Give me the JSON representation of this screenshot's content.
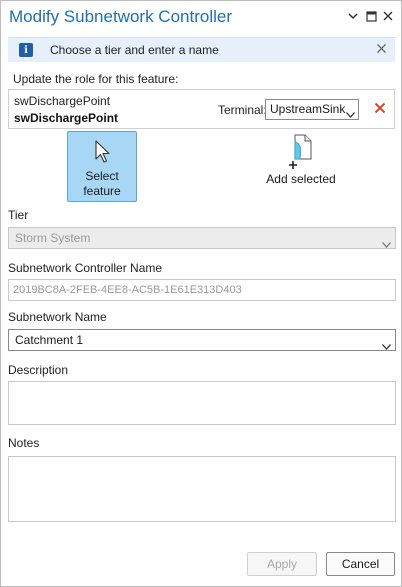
{
  "window": {
    "title": "Modify Subnetwork Controller",
    "controls": [
      "menu-chevron-icon",
      "maximize-icon",
      "close-icon"
    ]
  },
  "info_bar": {
    "icon": "info-icon",
    "message": "Choose a tier and enter a name"
  },
  "feature_section": {
    "label": "Update the role for this feature:",
    "feature_class": "swDischargePoint",
    "feature_name": "swDischargePoint",
    "terminal_label": "Terminal:",
    "terminal_value": "UpstreamSink"
  },
  "tools": {
    "select_feature": {
      "label_line1": "Select",
      "label_line2": "feature",
      "active": true
    },
    "add_selected": {
      "label": "Add selected"
    }
  },
  "tier": {
    "label": "Tier",
    "value": "Storm System",
    "enabled": false
  },
  "controller_name": {
    "label": "Subnetwork Controller Name",
    "placeholder": "2019BC8A-2FEB-4EE8-AC5B-1E61E313D403"
  },
  "subnetwork_name": {
    "label": "Subnetwork Name",
    "value": "Catchment 1"
  },
  "description": {
    "label": "Description",
    "value": ""
  },
  "notes": {
    "label": "Notes",
    "value": ""
  },
  "footer": {
    "apply_label": "Apply",
    "apply_enabled": false,
    "cancel_label": "Cancel"
  },
  "colors": {
    "title": "#1f6fb2",
    "info_bg": "#e6f0fa",
    "active_tool_bg": "#a8d6f5",
    "remove_icon": "#d9452b"
  }
}
